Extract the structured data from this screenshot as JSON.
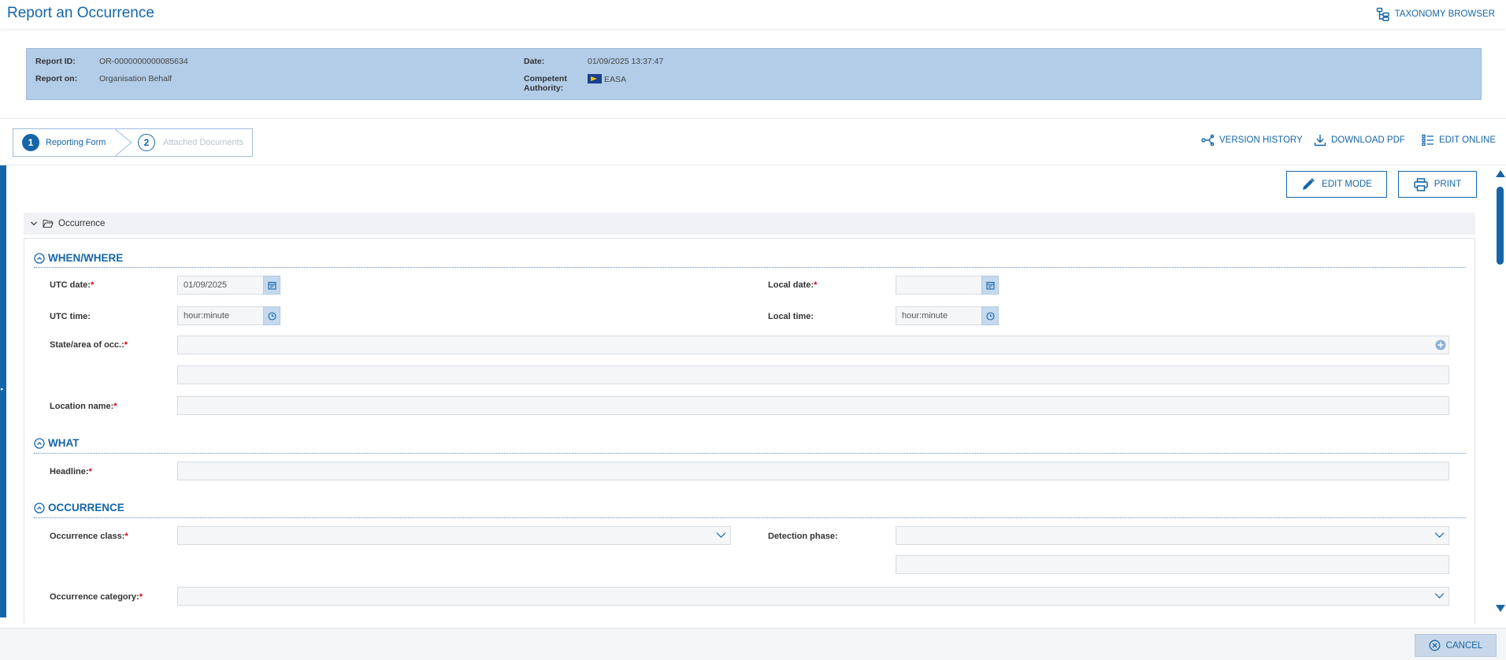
{
  "header": {
    "title": "Report an Occurrence",
    "taxonomy_label": "TAXONOMY BROWSER"
  },
  "info": {
    "report_id_label": "Report ID:",
    "report_id_value": "OR-0000000000085634",
    "report_on_label": "Report on:",
    "report_on_value": "Organisation Behalf",
    "date_label": "Date:",
    "date_value": "01/09/2025 13:37:47",
    "authority_label_1": "Competent",
    "authority_label_2": "Authority:",
    "authority_value": "EASA"
  },
  "steps": [
    {
      "number": "1",
      "label": "Reporting Form"
    },
    {
      "number": "2",
      "label": "Attached Documents"
    }
  ],
  "actions": {
    "version_history": "VERSION HISTORY",
    "download_pdf": "DOWNLOAD PDF",
    "edit_online": "EDIT ONLINE",
    "edit_mode": "EDIT MODE",
    "print": "PRINT",
    "cancel": "CANCEL"
  },
  "form": {
    "panel_title": "Occurrence",
    "sections": {
      "when_where": "WHEN/WHERE",
      "what": "WHAT",
      "occurrence": "OCCURRENCE"
    },
    "fields": {
      "utc_date": {
        "label": "UTC date:",
        "value": "01/09/2025"
      },
      "local_date": {
        "label": "Local date:",
        "value": ""
      },
      "utc_time": {
        "label": "UTC time:",
        "placeholder": "hour:minute"
      },
      "local_time": {
        "label": "Local time:",
        "placeholder": "hour:minute"
      },
      "state_area": {
        "label": "State/area of occ.:"
      },
      "location_name": {
        "label": "Location name:"
      },
      "headline": {
        "label": "Headline:"
      },
      "occurrence_class": {
        "label": "Occurrence class:"
      },
      "detection_phase": {
        "label": "Detection phase:"
      },
      "occurrence_category": {
        "label": "Occurrence category:"
      }
    },
    "required_marker": "*"
  },
  "colors": {
    "brand": "#1565a8",
    "banner": "#b3cde8",
    "required": "#d0021b"
  }
}
